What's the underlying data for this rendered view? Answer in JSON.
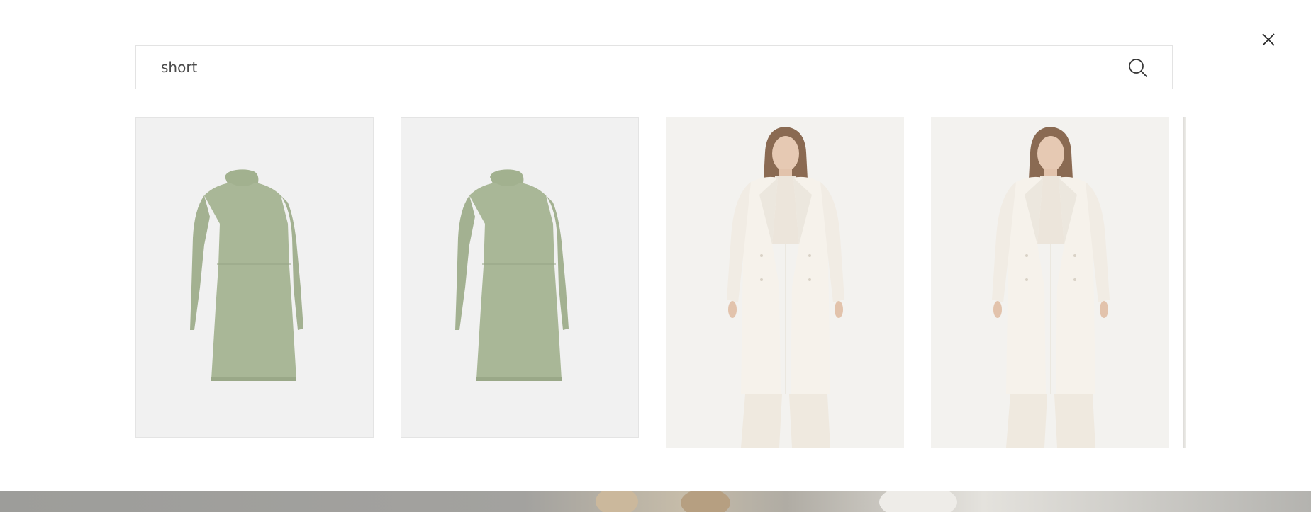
{
  "search": {
    "value": "short",
    "placeholder": ""
  },
  "icons": {
    "close": "close-icon",
    "search": "search-icon"
  },
  "results": [
    {
      "product": "green-dress",
      "image": "dress-image",
      "color": "#a9b797"
    },
    {
      "product": "green-dress",
      "image": "dress-image",
      "color": "#a9b797"
    },
    {
      "product": "white-coat",
      "image": "coat-model-image",
      "color": "#f5f1ea"
    },
    {
      "product": "white-coat",
      "image": "coat-model-image",
      "color": "#f5f1ea"
    },
    {
      "product": "partially-visible-product",
      "image": "product-image",
      "color": "#dddcd8"
    }
  ],
  "colors": {
    "background": "#ffffff",
    "border": "#e3e3e3",
    "text": "#4a4a4a",
    "dress_bg": "#f1f1f1",
    "coat_bg": "#f3f2ef",
    "band": "#a3a29f"
  }
}
